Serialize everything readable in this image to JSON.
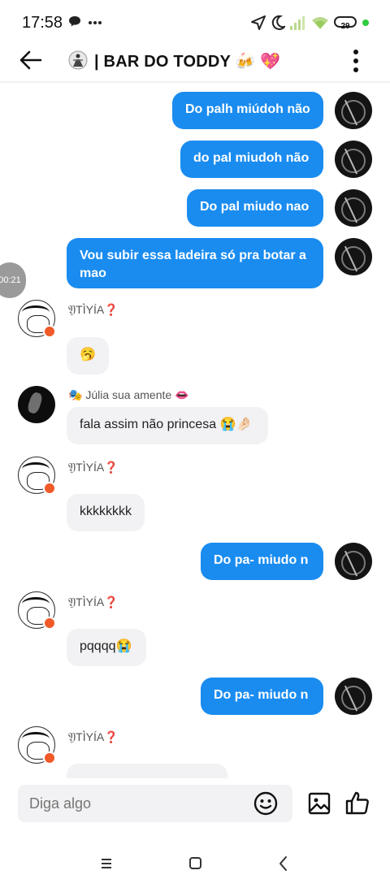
{
  "status_bar": {
    "time": "17:58",
    "battery": "29"
  },
  "header": {
    "title": "| BAR DO TODDY 🍻 💖"
  },
  "timestamp_pill": "00:21",
  "messages": [
    {
      "text": "Do palh miúdoh não"
    },
    {
      "text": "do pal miudoh não"
    },
    {
      "text": "Do pal miudo nao"
    },
    {
      "text": "Vou subir essa ladeira só pra botar a mao"
    },
    {
      "sender": "𝔜TÌ̀YÍA❓",
      "text": "🥱"
    },
    {
      "sender": "🎭 Júlia sua amente 👄",
      "text": "fala assim não princesa 😭🤌🏻"
    },
    {
      "sender": "𝔜TÌ̀YÍA❓",
      "text": "kkkkkkkk"
    },
    {
      "text": "Do pa- miudo n"
    },
    {
      "sender": "𝔜TÌ̀YÍA❓",
      "text": "pqqqq😭"
    },
    {
      "text": "Do pa- miudo n"
    },
    {
      "sender": "𝔜TÌ̀YÍA❓",
      "text": ""
    }
  ],
  "input": {
    "placeholder": "Diga algo"
  },
  "icons": {
    "back": "arrow-left-icon",
    "menu": "more-vertical-icon",
    "emoji": "smiley-icon",
    "image": "image-icon",
    "like": "thumbs-up-icon",
    "nav_recents": "menu-lines-icon",
    "nav_home": "square-icon",
    "nav_back": "chevron-left-icon"
  },
  "colors": {
    "outgoing_bubble": "#1a8cf0",
    "incoming_bubble": "#f2f2f4",
    "badge": "#f05a28"
  }
}
